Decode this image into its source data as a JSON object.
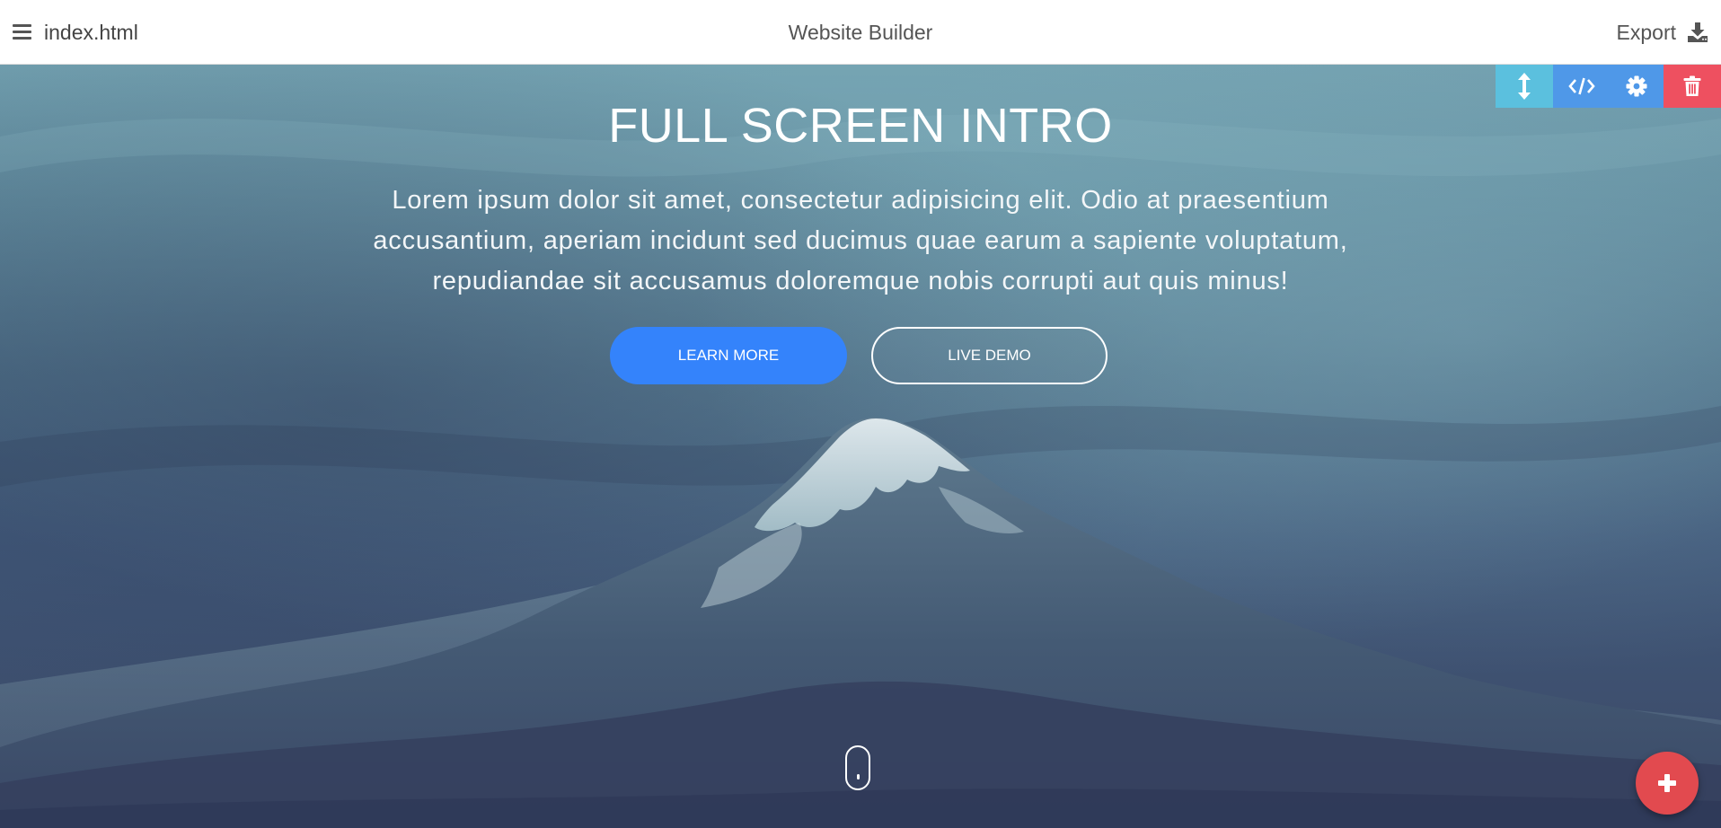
{
  "topbar": {
    "filename": "index.html",
    "app_title": "Website Builder",
    "export_label": "Export",
    "menu_icon": "hamburger-menu-icon",
    "export_icon": "download-icon"
  },
  "hero": {
    "title": "FULL SCREEN INTRO",
    "text": "Lorem ipsum dolor sit amet, consectetur adipisicing elit. Odio at praesentium accusantium, aperiam incidunt sed ducimus quae earum a sapiente voluptatum, repudiandae sit accusamus doloremque nobis corrupti aut quis minus!",
    "learn_more_label": "LEARN MORE",
    "live_demo_label": "LIVE DEMO",
    "background": "mountain-landscape-image"
  },
  "block_toolbar": {
    "items": [
      {
        "icon": "resize-vertical-icon",
        "color": "#5bc0de"
      },
      {
        "icon": "code-icon",
        "color": "#4f98e8"
      },
      {
        "icon": "gear-icon",
        "color": "#4f98e8"
      },
      {
        "icon": "trash-icon",
        "color": "#ee5060"
      }
    ]
  },
  "fab": {
    "icon": "plus-icon",
    "color": "#e24a4f"
  },
  "colors": {
    "primary_button": "#3483fb",
    "topbar_bg": "#ffffff"
  }
}
